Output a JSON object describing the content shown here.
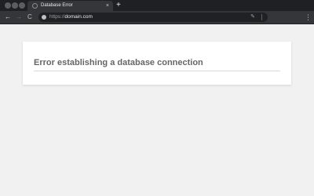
{
  "browser": {
    "tab": {
      "title": "Database Error",
      "close_glyph": "×",
      "favicon_icon": "globe-outline-icon"
    },
    "new_tab_glyph": "+",
    "toolbar": {
      "back_glyph": "←",
      "forward_glyph": "→",
      "reload_glyph": "C",
      "menu_glyph": "⋮"
    },
    "address_bar": {
      "scheme": "https://",
      "host": "domain.com",
      "security_icon": "globe-icon",
      "edit_icon": "pencil-icon"
    }
  },
  "page": {
    "error_title": "Error establishing a database connection"
  },
  "colors": {
    "tabstrip": "#1f2022",
    "toolbar": "#35363a",
    "omnibox": "#202124",
    "page_background": "#f1f1f1",
    "card": "#ffffff",
    "title_text": "#666666"
  }
}
